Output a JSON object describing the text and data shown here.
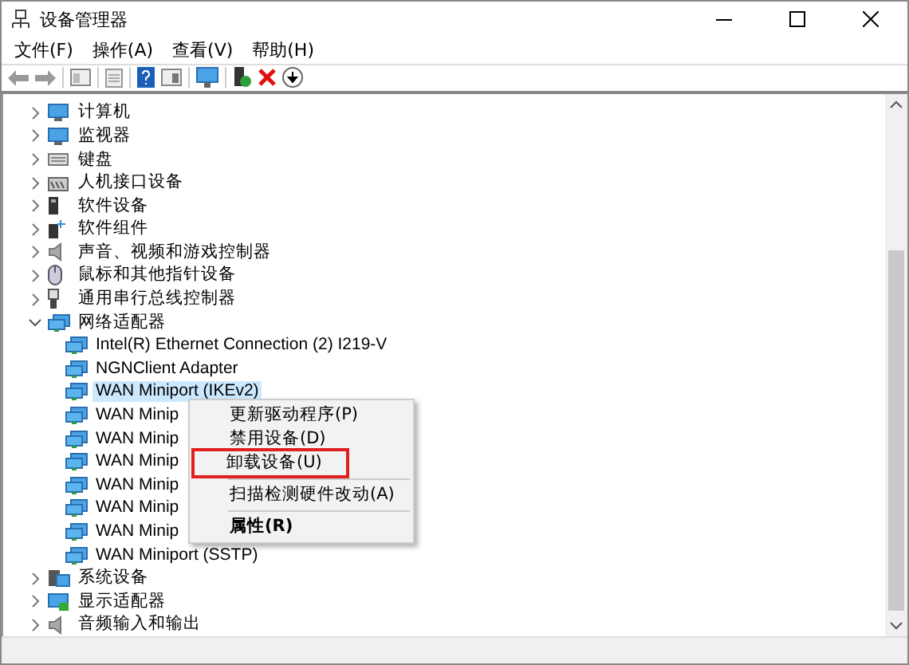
{
  "window": {
    "title": "设备管理器"
  },
  "menu_bar": [
    {
      "label": "文件(F)"
    },
    {
      "label": "操作(A)"
    },
    {
      "label": "查看(V)"
    },
    {
      "label": "帮助(H)"
    }
  ],
  "tree": [
    {
      "label": "计算机",
      "expanded": false,
      "selected": false
    },
    {
      "label": "监视器",
      "expanded": false,
      "selected": false
    },
    {
      "label": "键盘",
      "expanded": false,
      "selected": false
    },
    {
      "label": "人机接口设备",
      "expanded": false,
      "selected": false
    },
    {
      "label": "软件设备",
      "expanded": false,
      "selected": false
    },
    {
      "label": "软件组件",
      "expanded": false,
      "selected": false
    },
    {
      "label": "声音、视频和游戏控制器",
      "expanded": false,
      "selected": false
    },
    {
      "label": "鼠标和其他指针设备",
      "expanded": false,
      "selected": false
    },
    {
      "label": "通用串行总线控制器",
      "expanded": false,
      "selected": false
    },
    {
      "label": "网络适配器",
      "expanded": true,
      "selected": false,
      "children": [
        {
          "label": "Intel(R) Ethernet Connection (2) I219-V",
          "selected": false
        },
        {
          "label": "NGNClient Adapter",
          "selected": false
        },
        {
          "label": "WAN Miniport (IKEv2)",
          "selected": true
        },
        {
          "label": "WAN Minip",
          "selected": false
        },
        {
          "label": "WAN Minip",
          "selected": false
        },
        {
          "label": "WAN Minip",
          "selected": false
        },
        {
          "label": "WAN Minip",
          "selected": false
        },
        {
          "label": "WAN Minip",
          "selected": false
        },
        {
          "label": "WAN Minip",
          "selected": false
        },
        {
          "label": "WAN Miniport (SSTP)",
          "selected": false
        }
      ]
    },
    {
      "label": "系统设备",
      "expanded": false,
      "selected": false
    },
    {
      "label": "显示适配器",
      "expanded": false,
      "selected": false
    },
    {
      "label": "音频输入和输出",
      "expanded": false,
      "selected": false
    }
  ],
  "context_menu": {
    "items": [
      {
        "kind": "item",
        "label": "更新驱动程序(P)",
        "highlighted": false
      },
      {
        "kind": "item",
        "label": "禁用设备(D)",
        "highlighted": false
      },
      {
        "kind": "item",
        "label": "卸载设备(U)",
        "highlighted": true
      },
      {
        "kind": "separator"
      },
      {
        "kind": "item",
        "label": "扫描检测硬件改动(A)",
        "highlighted": false
      },
      {
        "kind": "separator"
      },
      {
        "kind": "default",
        "label": "属性(R)",
        "highlighted": false
      }
    ]
  }
}
